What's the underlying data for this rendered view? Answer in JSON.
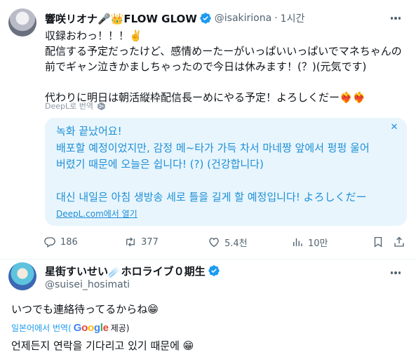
{
  "colors": {
    "accent": "#1d9bf0",
    "secondary_text": "#536471",
    "primary_text": "#0f1419",
    "translation_bg": "#e8f5fd",
    "verified": "#1d9bf0"
  },
  "tweet": {
    "author_name": "響咲リオナ🎤👑FLOW GLOW",
    "handle": "@isakiriona",
    "separator": "·",
    "time": "1시간",
    "text_lines": [
      "収録おわっ！！！✌️",
      "配信する予定だったけど、感情めーたーがいっぱいいっぱいでマネちゃんの",
      "前でギャン泣きかましちゃったので今日は休みます！(？)(元気です)",
      "",
      "代わりに明日は朝活縦枠配信長ーめにやる予定！よろしくだー❤️‍🔥❤️‍🔥"
    ],
    "translate_label": "DeepL로 번역",
    "translation": {
      "lines": [
        "녹화 끝났어요!",
        "배포할 예정이었지만, 감정 메~타가 가득 차서 마네짱 앞에서 펑펑 울어",
        "버렸기 때문에 오늘은 쉽니다! (?) (건강합니다)",
        "",
        "대신 내일은 아침 생방송 세로 틀을 길게 할 예정입니다! よろしくだー"
      ],
      "close_icon": "close-icon",
      "open_link": "DeepL.com에서 열기"
    },
    "actions": {
      "replies": "186",
      "reposts": "377",
      "likes": "5.4천",
      "views": "10만"
    }
  },
  "reply": {
    "author_name": "星街すいせい☄️ホロライブ０期生",
    "handle": "@suisei_hosimati",
    "text": "いつでも連絡待ってるからね😁",
    "translate_prefix": "일본어에서 번역(",
    "google_label": "Google",
    "translate_suffix": "제공)",
    "translated_text": "언제든지 연락을 기다리고 있기 때문에 😁"
  }
}
